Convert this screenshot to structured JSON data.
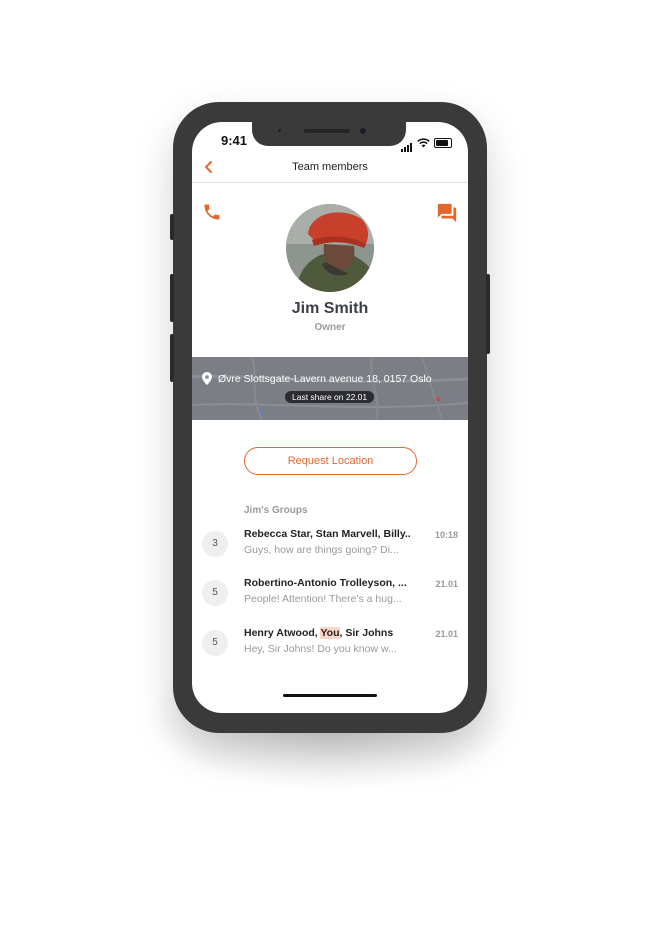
{
  "status": {
    "time": "9:41"
  },
  "nav": {
    "title": "Team members",
    "back_icon": "chevron-left-icon"
  },
  "profile": {
    "name": "Jim Smith",
    "role": "Owner"
  },
  "location": {
    "address": "Øvre Slottsgate-Lavern avenue 18, 0157 Oslo",
    "last_share": "Last share on 22.01"
  },
  "actions": {
    "request_label": "Request Location",
    "call_icon": "phone-icon",
    "chat_icon": "chat-icon"
  },
  "groups": {
    "title": "Jim's Groups",
    "items": [
      {
        "count": "3",
        "title": "Rebecca Star, Stan Marvell, Billy..",
        "preview": "Guys, how are things going? Di...",
        "time": "10:18"
      },
      {
        "count": "5",
        "title": "Robertino-Antonio Trolleyson, ...",
        "preview": "People! Attention! There's a hug...",
        "time": "21.01"
      },
      {
        "count": "5",
        "title_before": "Henry Atwood, ",
        "title_highlight": "You",
        "title_after": ", Sir Johns",
        "preview": "Hey, Sir Johns! Do you know w...",
        "time": "21.01"
      }
    ]
  },
  "colors": {
    "accent": "#e3672c",
    "phone_frame": "#3a3a3a",
    "map_overlay": "#7d8187"
  }
}
